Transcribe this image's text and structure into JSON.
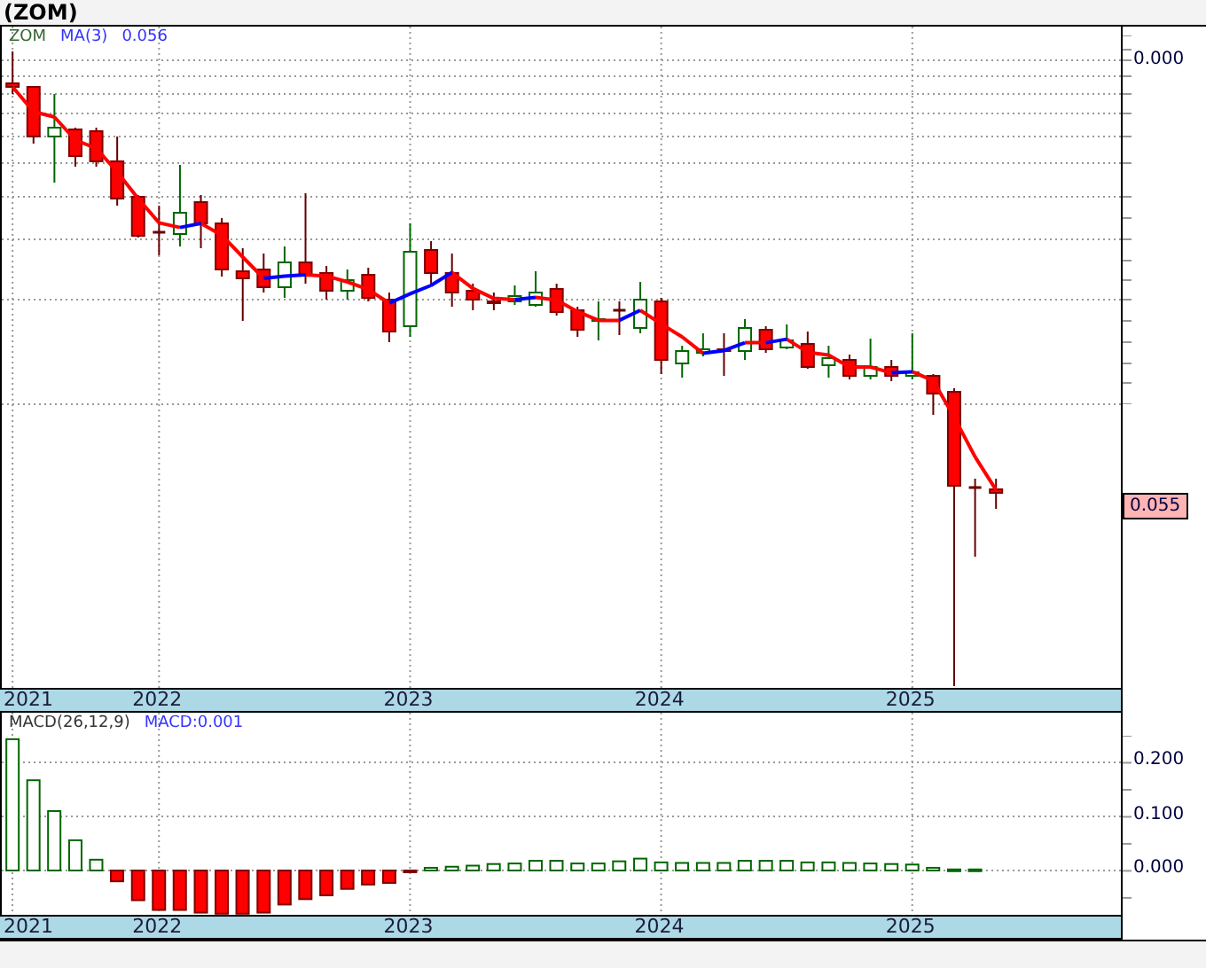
{
  "title": "(ZOM)",
  "price_pane": {
    "legend": {
      "symbol": "ZOM",
      "indicator": "MA(3)",
      "value": "0.056"
    },
    "axis_label": "0.000",
    "last_price": "0.055",
    "x_labels": [
      "2021",
      "2022",
      "2023",
      "2024",
      "2025"
    ]
  },
  "macd_pane": {
    "legend": "MACD(26,12,9)",
    "value_label": "MACD:0.001",
    "first_x_label": "2021",
    "chart_data": {
      "type": "bar",
      "x": [
        2021.417,
        2021.5,
        2021.583,
        2021.667,
        2021.75,
        2021.833,
        2021.917,
        2022,
        2022.083,
        2022.167,
        2022.25,
        2022.333,
        2022.417,
        2022.5,
        2022.583,
        2022.667,
        2022.75,
        2022.833,
        2022.917,
        2023,
        2023.083,
        2023.167,
        2023.25,
        2023.333,
        2023.417,
        2023.5,
        2023.583,
        2023.667,
        2023.75,
        2023.833,
        2023.917,
        2024,
        2024.083,
        2024.167,
        2024.25,
        2024.333,
        2024.417,
        2024.5,
        2024.583,
        2024.667,
        2024.75,
        2024.833,
        2024.917,
        2025,
        2025.083,
        2025.167,
        2025.25
      ],
      "values": [
        0.243,
        0.167,
        0.11,
        0.056,
        0.02,
        -0.02,
        -0.055,
        -0.073,
        -0.073,
        -0.078,
        -0.08,
        -0.08,
        -0.078,
        -0.063,
        -0.053,
        -0.046,
        -0.034,
        -0.026,
        -0.023,
        -0.003,
        0.005,
        0.007,
        0.009,
        0.012,
        0.013,
        0.018,
        0.018,
        0.013,
        0.013,
        0.017,
        0.022,
        0.015,
        0.014,
        0.014,
        0.014,
        0.018,
        0.018,
        0.018,
        0.015,
        0.015,
        0.014,
        0.013,
        0.012,
        0.011,
        0.005,
        0.002,
        0.002
      ],
      "xlim": [
        2021.374,
        2025.838
      ],
      "ylim": [
        -0.082,
        0.292
      ],
      "yticks": [
        {
          "value": 0,
          "label": "0.000"
        },
        {
          "value": 0.1,
          "label": "0.100"
        },
        {
          "value": 0.2,
          "label": "0.200"
        }
      ],
      "xticks": [
        2022,
        2023,
        2024,
        2025
      ],
      "grid": true
    }
  }
}
